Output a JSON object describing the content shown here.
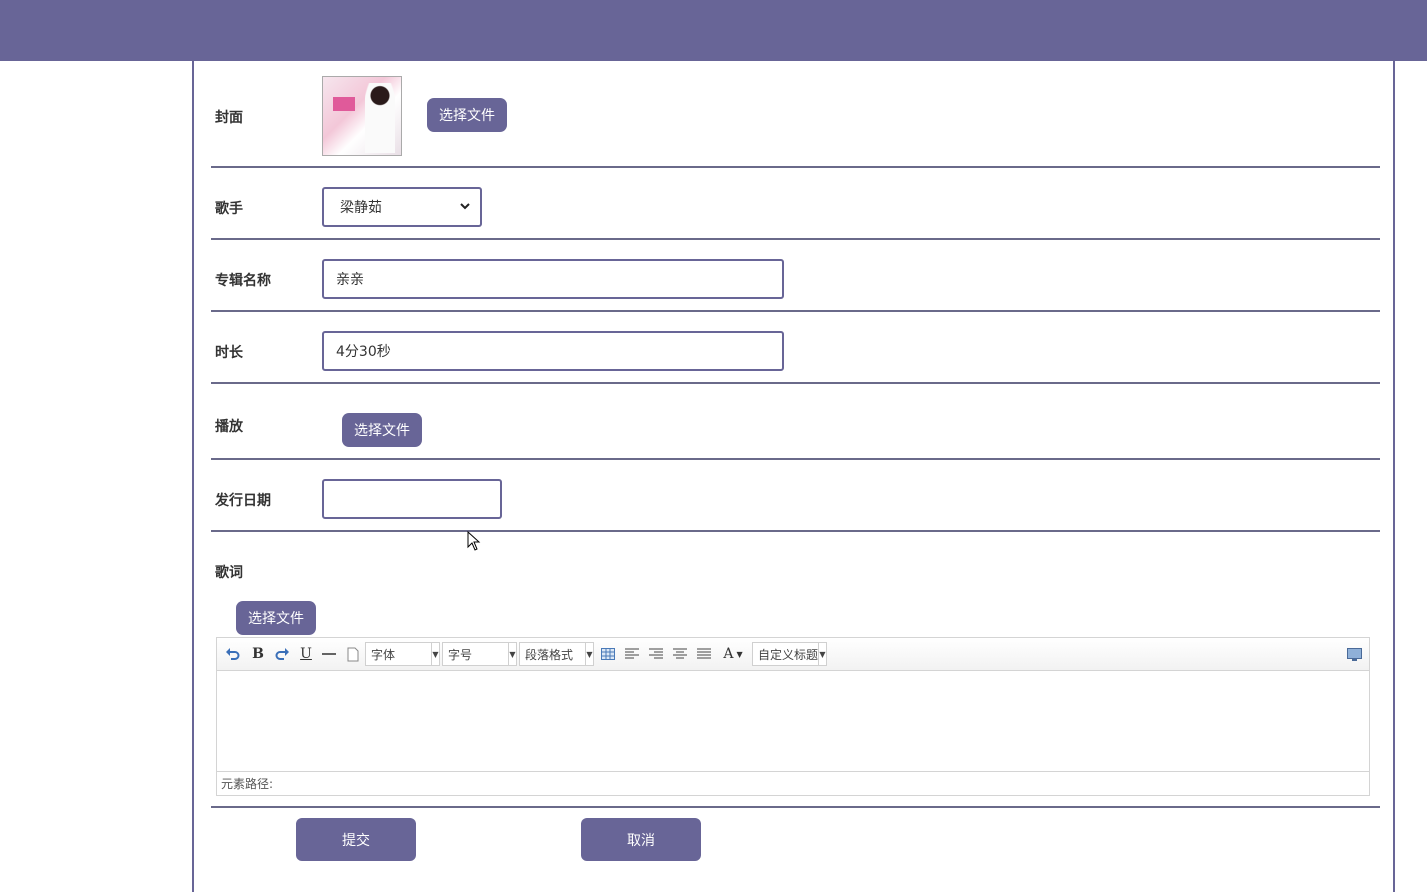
{
  "form": {
    "cover": {
      "label": "封面",
      "choose_file": "选择文件"
    },
    "singer": {
      "label": "歌手",
      "value": "梁静茹"
    },
    "album": {
      "label": "专辑名称",
      "value": "亲亲"
    },
    "duration": {
      "label": "时长",
      "value": "4分30秒"
    },
    "play": {
      "label": "播放",
      "choose_file": "选择文件"
    },
    "release_date": {
      "label": "发行日期",
      "value": ""
    },
    "lyrics": {
      "label": "歌词",
      "choose_file": "选择文件"
    }
  },
  "editor": {
    "font_family": "字体",
    "font_size": "字号",
    "paragraph": "段落格式",
    "custom_heading": "自定义标题",
    "bold": "B",
    "underline": "U",
    "font_color": "A",
    "element_path": "元素路径:"
  },
  "actions": {
    "submit": "提交",
    "cancel": "取消"
  },
  "colors": {
    "accent": "#686597"
  }
}
